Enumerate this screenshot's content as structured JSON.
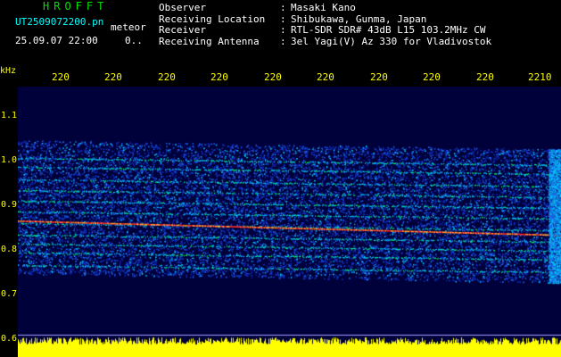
{
  "header": {
    "app_title": "HROFFT",
    "file_name": "UT2509072200.pn",
    "mode": "meteor",
    "datetime": "25.09.07 22:00",
    "counter": "0.."
  },
  "info": [
    {
      "label": "Observer",
      "value": "Masaki Kano"
    },
    {
      "label": "Receiving Location",
      "value": "Shibukawa, Gunma, Japan"
    },
    {
      "label": "Receiver",
      "value": "RTL-SDR SDR# 43dB L15 103.2MHz CW"
    },
    {
      "label": "Receiving Antenna",
      "value": "3el Yagi(V) Az 330 for Vladivostok"
    }
  ],
  "axis": {
    "unit": "kHz",
    "x_ticks": [
      "220",
      "220",
      "220",
      "220",
      "220",
      "220",
      "220",
      "220",
      "220",
      "2210"
    ],
    "y_ticks": [
      "1.1",
      "1.0",
      "0.9",
      "0.8",
      "0.7",
      "0.6"
    ]
  },
  "colors": {
    "background": "#000000",
    "plot_bg": "#00003a",
    "axis_text": "#ffff00",
    "title": "#00e000",
    "filename": "#00ffff",
    "header_text": "#ffffff",
    "signal_low": "#1030c0",
    "signal_mid": "#00c8ff",
    "signal_high": "#00ff60",
    "carrier": "#ff2020",
    "meter": "#ffff00"
  }
}
